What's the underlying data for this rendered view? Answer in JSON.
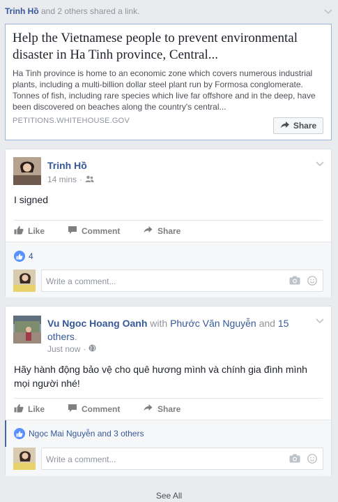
{
  "shared_header": {
    "actor": "Trinh Hồ",
    "rest": " and 2 others shared a link."
  },
  "link": {
    "title": "Help the Vietnamese people to prevent environmental disaster in Ha Tinh province, Central...",
    "description": "Ha Tinh province is home to an economic zone which covers numerous industrial plants, including a multi-billion dollar steel plant run by Formosa conglomerate. Tonnes of fish, including rare species which live far offshore and in the deep, have been discovered on beaches along the country's central...",
    "domain": "PETITIONS.WHITEHOUSE.GOV",
    "share_label": "Share"
  },
  "post1": {
    "author": "Trinh Hồ",
    "time": "14 mins",
    "privacy_icon": "friends-icon",
    "text": "I signed",
    "actions": {
      "like": "Like",
      "comment": "Comment",
      "share": "Share"
    },
    "like_count": "4",
    "comment_placeholder": "Write a comment..."
  },
  "post2": {
    "author": "Vu Ngoc Hoang Oanh",
    "with_text": " with ",
    "tagged": "Phước Văn Nguyễn",
    "and_text": " and ",
    "others": "15 others",
    "period": ".",
    "time": "Just now",
    "privacy_icon": "globe-icon",
    "text": "Hãy hành động bảo vệ cho quê hương mình và chính gia đình mình mọi người nhé!",
    "actions": {
      "like": "Like",
      "comment": "Comment",
      "share": "Share"
    },
    "likers_name": "Ngọc Mai Nguyễn",
    "likers_rest": " and 3 others",
    "comment_placeholder": "Write a comment..."
  },
  "footer": {
    "see_all": "See All"
  },
  "colors": {
    "link_blue": "#365899",
    "like_blue": "#5890ff",
    "border_blue": "#9cb4d8"
  }
}
